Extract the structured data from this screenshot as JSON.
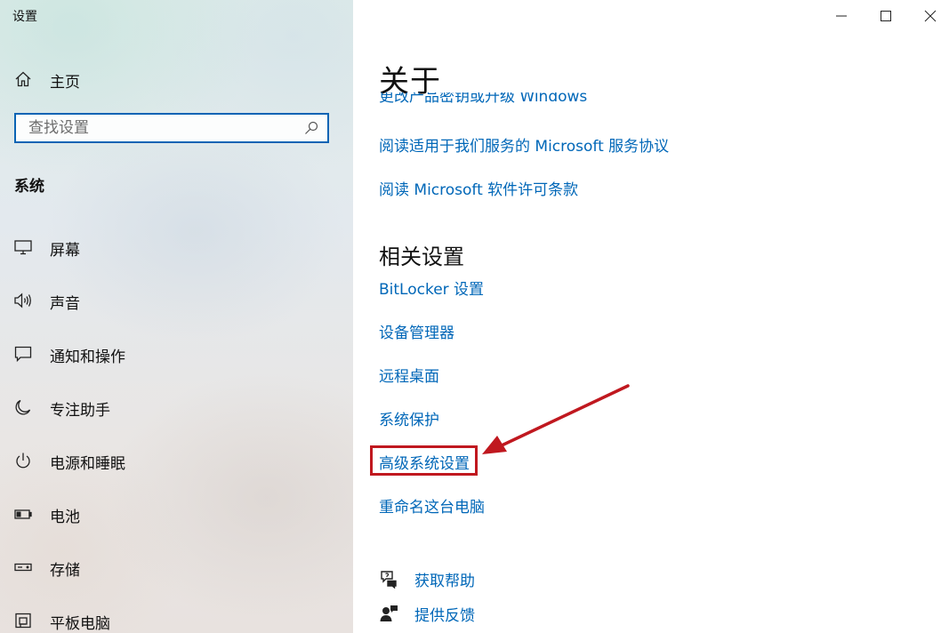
{
  "window": {
    "title": "设置",
    "controls": {
      "minimize": "minimize-icon",
      "maximize": "maximize-icon",
      "close": "close-icon"
    }
  },
  "sidebar": {
    "home": {
      "label": "主页",
      "icon": "home-icon"
    },
    "search": {
      "placeholder": "查找设置",
      "value": "",
      "icon": "search-icon"
    },
    "section_title": "系统",
    "items": [
      {
        "label": "屏幕",
        "icon": "display-icon"
      },
      {
        "label": "声音",
        "icon": "speaker-icon"
      },
      {
        "label": "通知和操作",
        "icon": "notification-icon"
      },
      {
        "label": "专注助手",
        "icon": "moon-icon"
      },
      {
        "label": "电源和睡眠",
        "icon": "power-icon"
      },
      {
        "label": "电池",
        "icon": "battery-icon"
      },
      {
        "label": "存储",
        "icon": "storage-icon"
      },
      {
        "label": "平板电脑",
        "icon": "tablet-icon"
      }
    ]
  },
  "main": {
    "page_title": "关于",
    "partial_link": "更改产品密钥或升级 Windows",
    "links": [
      "阅读适用于我们服务的 Microsoft 服务协议",
      "阅读 Microsoft 软件许可条款"
    ],
    "related": {
      "title": "相关设置",
      "links": [
        "BitLocker 设置",
        "设备管理器",
        "远程桌面",
        "系统保护",
        "高级系统设置",
        "重命名这台电脑"
      ],
      "highlighted_index": 4
    },
    "help": [
      {
        "label": "获取帮助",
        "icon": "help-chat-icon"
      },
      {
        "label": "提供反馈",
        "icon": "feedback-icon"
      }
    ]
  },
  "colors": {
    "link": "#0067b8",
    "accent": "#0a64b4",
    "annotation": "#c0181f"
  }
}
